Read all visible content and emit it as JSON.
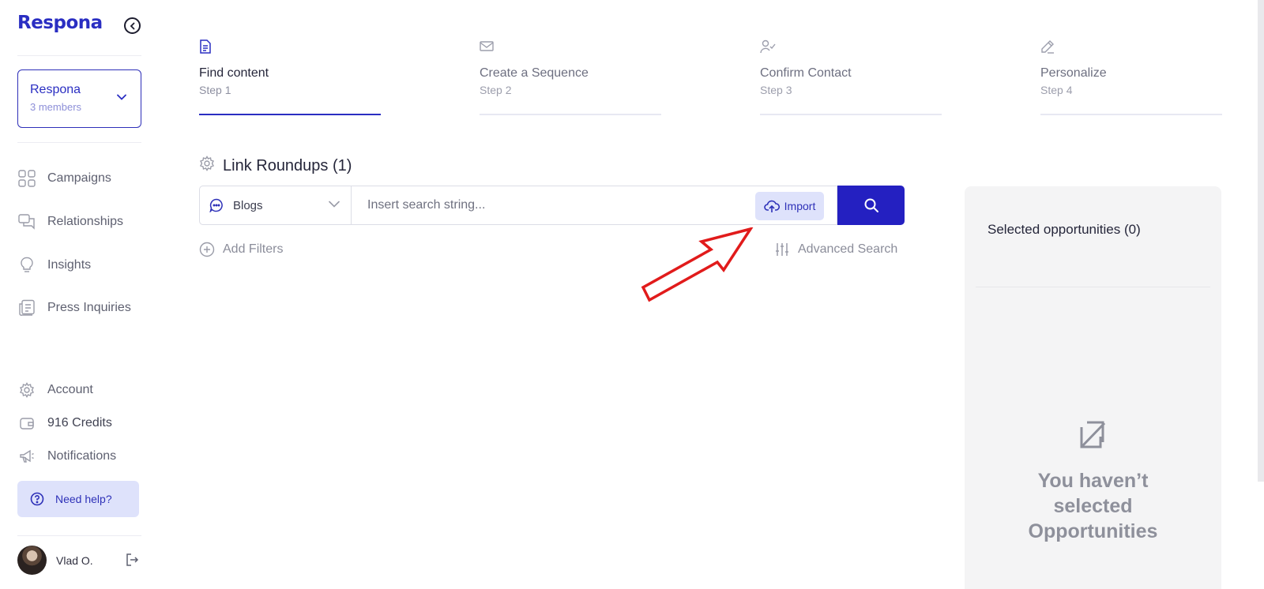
{
  "brand": {
    "logo": "Respona",
    "accent": "#2a2ec2"
  },
  "workspace": {
    "name": "Respona",
    "members": "3 members"
  },
  "nav": {
    "main": [
      {
        "label": "Campaigns",
        "icon": "grid-icon"
      },
      {
        "label": "Relationships",
        "icon": "chat-icon"
      },
      {
        "label": "Insights",
        "icon": "lightbulb-icon"
      },
      {
        "label": "Press Inquiries",
        "icon": "newspaper-icon"
      }
    ],
    "bottom": [
      {
        "label": "Account",
        "icon": "gear-icon"
      },
      {
        "label": "916 Credits",
        "icon": "wallet-icon"
      },
      {
        "label": "Notifications",
        "icon": "megaphone-icon"
      }
    ],
    "help": "Need help?"
  },
  "user": {
    "name": "Vlad O."
  },
  "steps": [
    {
      "title": "Find content",
      "sub": "Step 1",
      "icon": "document-icon",
      "active": true
    },
    {
      "title": "Create a Sequence",
      "sub": "Step 2",
      "icon": "envelope-icon",
      "active": false
    },
    {
      "title": "Confirm Contact",
      "sub": "Step 3",
      "icon": "user-check-icon",
      "active": false
    },
    {
      "title": "Personalize",
      "sub": "Step 4",
      "icon": "pencil-icon",
      "active": false
    }
  ],
  "search": {
    "section_title": "Link Roundups (1)",
    "source_select": "Blogs",
    "placeholder": "Insert search string...",
    "import_label": "Import",
    "add_filters": "Add Filters",
    "advanced_search": "Advanced Search"
  },
  "panel": {
    "title": "Selected opportunities (0)",
    "empty_text": "You haven’t selected Opportunities"
  }
}
